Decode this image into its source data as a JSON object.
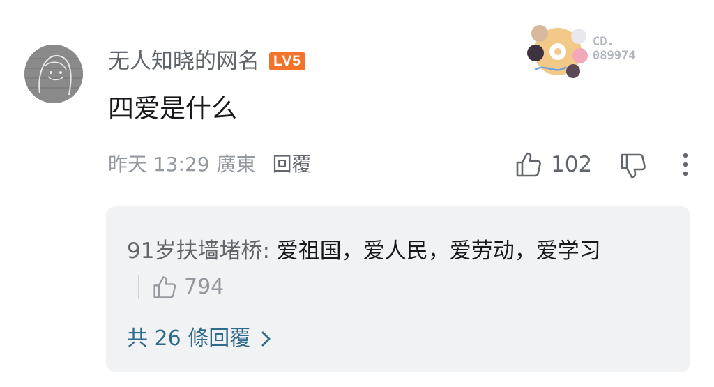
{
  "comment": {
    "username": "无人知晓的网名",
    "level": "LV5",
    "text": "四爱是什么",
    "time": "昨天 13:29",
    "location": "廣東",
    "reply_label": "回覆",
    "like_count": "102"
  },
  "badge": {
    "text_line1": "CD.",
    "text_line2": "089974"
  },
  "sub_replies": {
    "items": [
      {
        "author": "91岁扶墙堵桥",
        "separator": ":",
        "text": "爱祖国，爱人民，爱劳动，爱学习",
        "like_count": "794"
      }
    ],
    "see_more": "共 26 條回覆"
  },
  "icons": {
    "like": "thumbs-up-icon",
    "dislike": "thumbs-down-icon",
    "more": "more-vertical-icon",
    "chevron": "chevron-right-icon"
  },
  "colors": {
    "level_badge": "#f27329",
    "link": "#2f6b8c",
    "sub_box_bg": "#f1f2f3",
    "muted_text": "#9499a0"
  }
}
